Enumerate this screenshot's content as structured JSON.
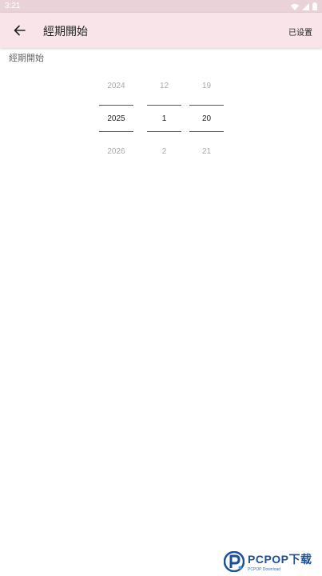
{
  "status_bar": {
    "time": "3:21",
    "icons": [
      "wifi-icon",
      "signal-icon",
      "battery-icon"
    ]
  },
  "app_bar": {
    "back_icon": "arrow-left-icon",
    "title": "經期開始",
    "action_label": "已设置"
  },
  "section": {
    "label": "經期開始"
  },
  "picker": {
    "year": {
      "prev": "2024",
      "selected": "2025",
      "next": "2026"
    },
    "month": {
      "prev": "12",
      "selected": "1",
      "next": "2"
    },
    "day": {
      "prev": "19",
      "selected": "20",
      "next": "21"
    }
  },
  "watermark": {
    "brand": "PCPOP下载",
    "sub": "PCPOP Download"
  },
  "colors": {
    "status_bar_bg": "#e9d3d8",
    "app_bar_bg": "#f9e5e9",
    "logo_blue": "#1c4f9c"
  }
}
